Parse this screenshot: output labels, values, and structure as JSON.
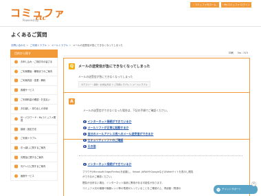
{
  "header": {
    "logo_text": "コミュファ",
    "logo_powered": "Powered by",
    "logo_ctc": "ctc",
    "buttons": [
      {
        "label": "コミュファ光ホーム"
      },
      {
        "label": "Myコミュファ ログイン"
      }
    ]
  },
  "page_title": "よくあるご質問",
  "breadcrumb": [
    "お問い合わせ",
    "ご利用トラブル",
    "メールトラブル",
    "メールの送受信が急にできなくなってしまった"
  ],
  "sidebar": {
    "heading": "目的から探す",
    "items": [
      {
        "label": "お申し込み・ご検討中の皆さま"
      },
      {
        "label": "ご利用開始・職場までのご案内"
      },
      {
        "label": "ご利用内容・変更・解約"
      },
      {
        "label": "各種サービス"
      },
      {
        "label": "ご利用料金の確認・お支払い"
      },
      {
        "label": "お引越し・持ち出しの手続"
      },
      {
        "label": "ID・パスワード・Myコミュファ関連"
      },
      {
        "label": "接続・設定方法"
      },
      {
        "label": "ご利用トラブル"
      },
      {
        "label": "引っ越しに関するご案内"
      },
      {
        "label": "光電話に関するご案内"
      },
      {
        "label": "光テレビに関するご案内"
      },
      {
        "label": "画面サービス"
      }
    ]
  },
  "topbar": {
    "print": "印刷",
    "version": "No : 315"
  },
  "question": {
    "mark": "Q",
    "title": "メールの送受信が急にできなくなってしまった",
    "text": "メールの送受信が急にできなくなってしまった",
    "tags": "カテゴリー : 契約・お支払方法 ＞ ご利用トラブル ＞ メールトラブル"
  },
  "answer": {
    "mark": "A",
    "intro": "メールの送受信ができなくなった場合は、下記の手順でご確認ください。",
    "toc": [
      {
        "num": "1",
        "label": "インターネット接続ができているか"
      },
      {
        "num": "2",
        "label": "メールソフトが正常に起動するか"
      },
      {
        "num": "3",
        "label": "自分のメールアドレス宛へのメール送受信ができるか"
      },
      {
        "num": "4",
        "label": "セキュリティソフトのご確認"
      },
      {
        "num": "5",
        "label": "その他"
      }
    ],
    "section1": {
      "num": "1",
      "label": "インターネット接続ができているか"
    },
    "body": [
      "ブラウザ(Microsoft Edge/Firefox)を起動し、Yahoo! JAPANやGoogleなどのWebサイトを表示し閲覧",
      "ができるかご確認ください。",
      "閲覧が出来ない場合、インターネット接続に異常がある可能性があります。",
      "コミュファ光の機器や機器レンジ等の電源が入っていることをご確認の上、再起動（電源の"
    ]
  },
  "chat": {
    "label": "チャットサポート",
    "close": "×"
  },
  "colors": {
    "accent": "#f29a3a",
    "link": "#2255a8",
    "chat": "#5aa4c8"
  }
}
